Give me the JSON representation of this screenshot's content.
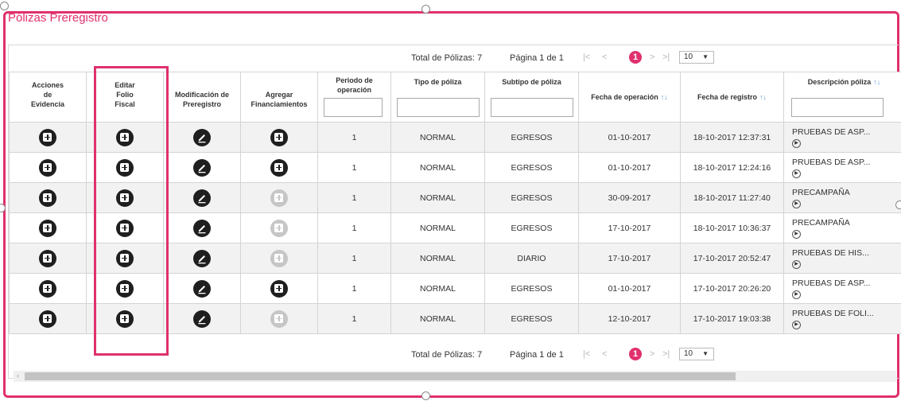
{
  "panel": {
    "title": "Pólizas Preregistro"
  },
  "pager_top": {
    "total": "Total de Pólizas: 7",
    "page": "Página 1 de 1",
    "first": "|<",
    "prev": "<",
    "current": "1",
    "next": ">",
    "last": ">|",
    "page_size": "10"
  },
  "pager_bottom": {
    "total": "Total de Pólizas: 7",
    "page": "Página 1 de 1",
    "first": "|<",
    "prev": "<",
    "current": "1",
    "next": ">",
    "last": ">|",
    "page_size": "10"
  },
  "headers": {
    "acciones_l1": "Acciones",
    "acciones_l2": "de",
    "acciones_l3": "Evidencia",
    "folio_l1": "Editar",
    "folio_l2": "Folio",
    "folio_l3": "Fiscal",
    "modif_l1": "Modificación de",
    "modif_l2": "Preregistro",
    "agregar_l1": "Agregar",
    "agregar_l2": "Financiamientos",
    "periodo_l1": "Periodo de",
    "periodo_l2": "operación",
    "tipo": "Tipo de póliza",
    "subtipo": "Subtipo de póliza",
    "fecha_op": "Fecha de operación",
    "fecha_reg": "Fecha de registro",
    "descripcion": "Descripción póliza",
    "sort_glyph": "↑↓"
  },
  "rows": [
    {
      "periodo": "1",
      "tipo": "NORMAL",
      "subtipo": "EGRESOS",
      "fecha_op": "01-10-2017",
      "fecha_reg": "18-10-2017 12:37:31",
      "descripcion": "PRUEBAS DE ASP...",
      "financiamiento_enabled": true
    },
    {
      "periodo": "1",
      "tipo": "NORMAL",
      "subtipo": "EGRESOS",
      "fecha_op": "01-10-2017",
      "fecha_reg": "18-10-2017 12:24:16",
      "descripcion": "PRUEBAS DE ASP...",
      "financiamiento_enabled": true
    },
    {
      "periodo": "1",
      "tipo": "NORMAL",
      "subtipo": "EGRESOS",
      "fecha_op": "30-09-2017",
      "fecha_reg": "18-10-2017 11:27:40",
      "descripcion": "PRECAMPAÑA",
      "financiamiento_enabled": false
    },
    {
      "periodo": "1",
      "tipo": "NORMAL",
      "subtipo": "EGRESOS",
      "fecha_op": "17-10-2017",
      "fecha_reg": "18-10-2017 10:36:37",
      "descripcion": "PRECAMPAÑA",
      "financiamiento_enabled": false
    },
    {
      "periodo": "1",
      "tipo": "NORMAL",
      "subtipo": "DIARIO",
      "fecha_op": "17-10-2017",
      "fecha_reg": "17-10-2017 20:52:47",
      "descripcion": "PRUEBAS DE HIS...",
      "financiamiento_enabled": false
    },
    {
      "periodo": "1",
      "tipo": "NORMAL",
      "subtipo": "EGRESOS",
      "fecha_op": "01-10-2017",
      "fecha_reg": "17-10-2017 20:26:20",
      "descripcion": "PRUEBAS DE ASP...",
      "financiamiento_enabled": true
    },
    {
      "periodo": "1",
      "tipo": "NORMAL",
      "subtipo": "EGRESOS",
      "fecha_op": "12-10-2017",
      "fecha_reg": "17-10-2017 19:03:38",
      "descripcion": "PRUEBAS DE FOLI...",
      "financiamiento_enabled": false
    }
  ],
  "colors": {
    "accent": "#e0306e",
    "icon_dark": "#1f1f1f",
    "icon_disabled": "#c6c6c6",
    "sort": "#5a9bd5"
  }
}
